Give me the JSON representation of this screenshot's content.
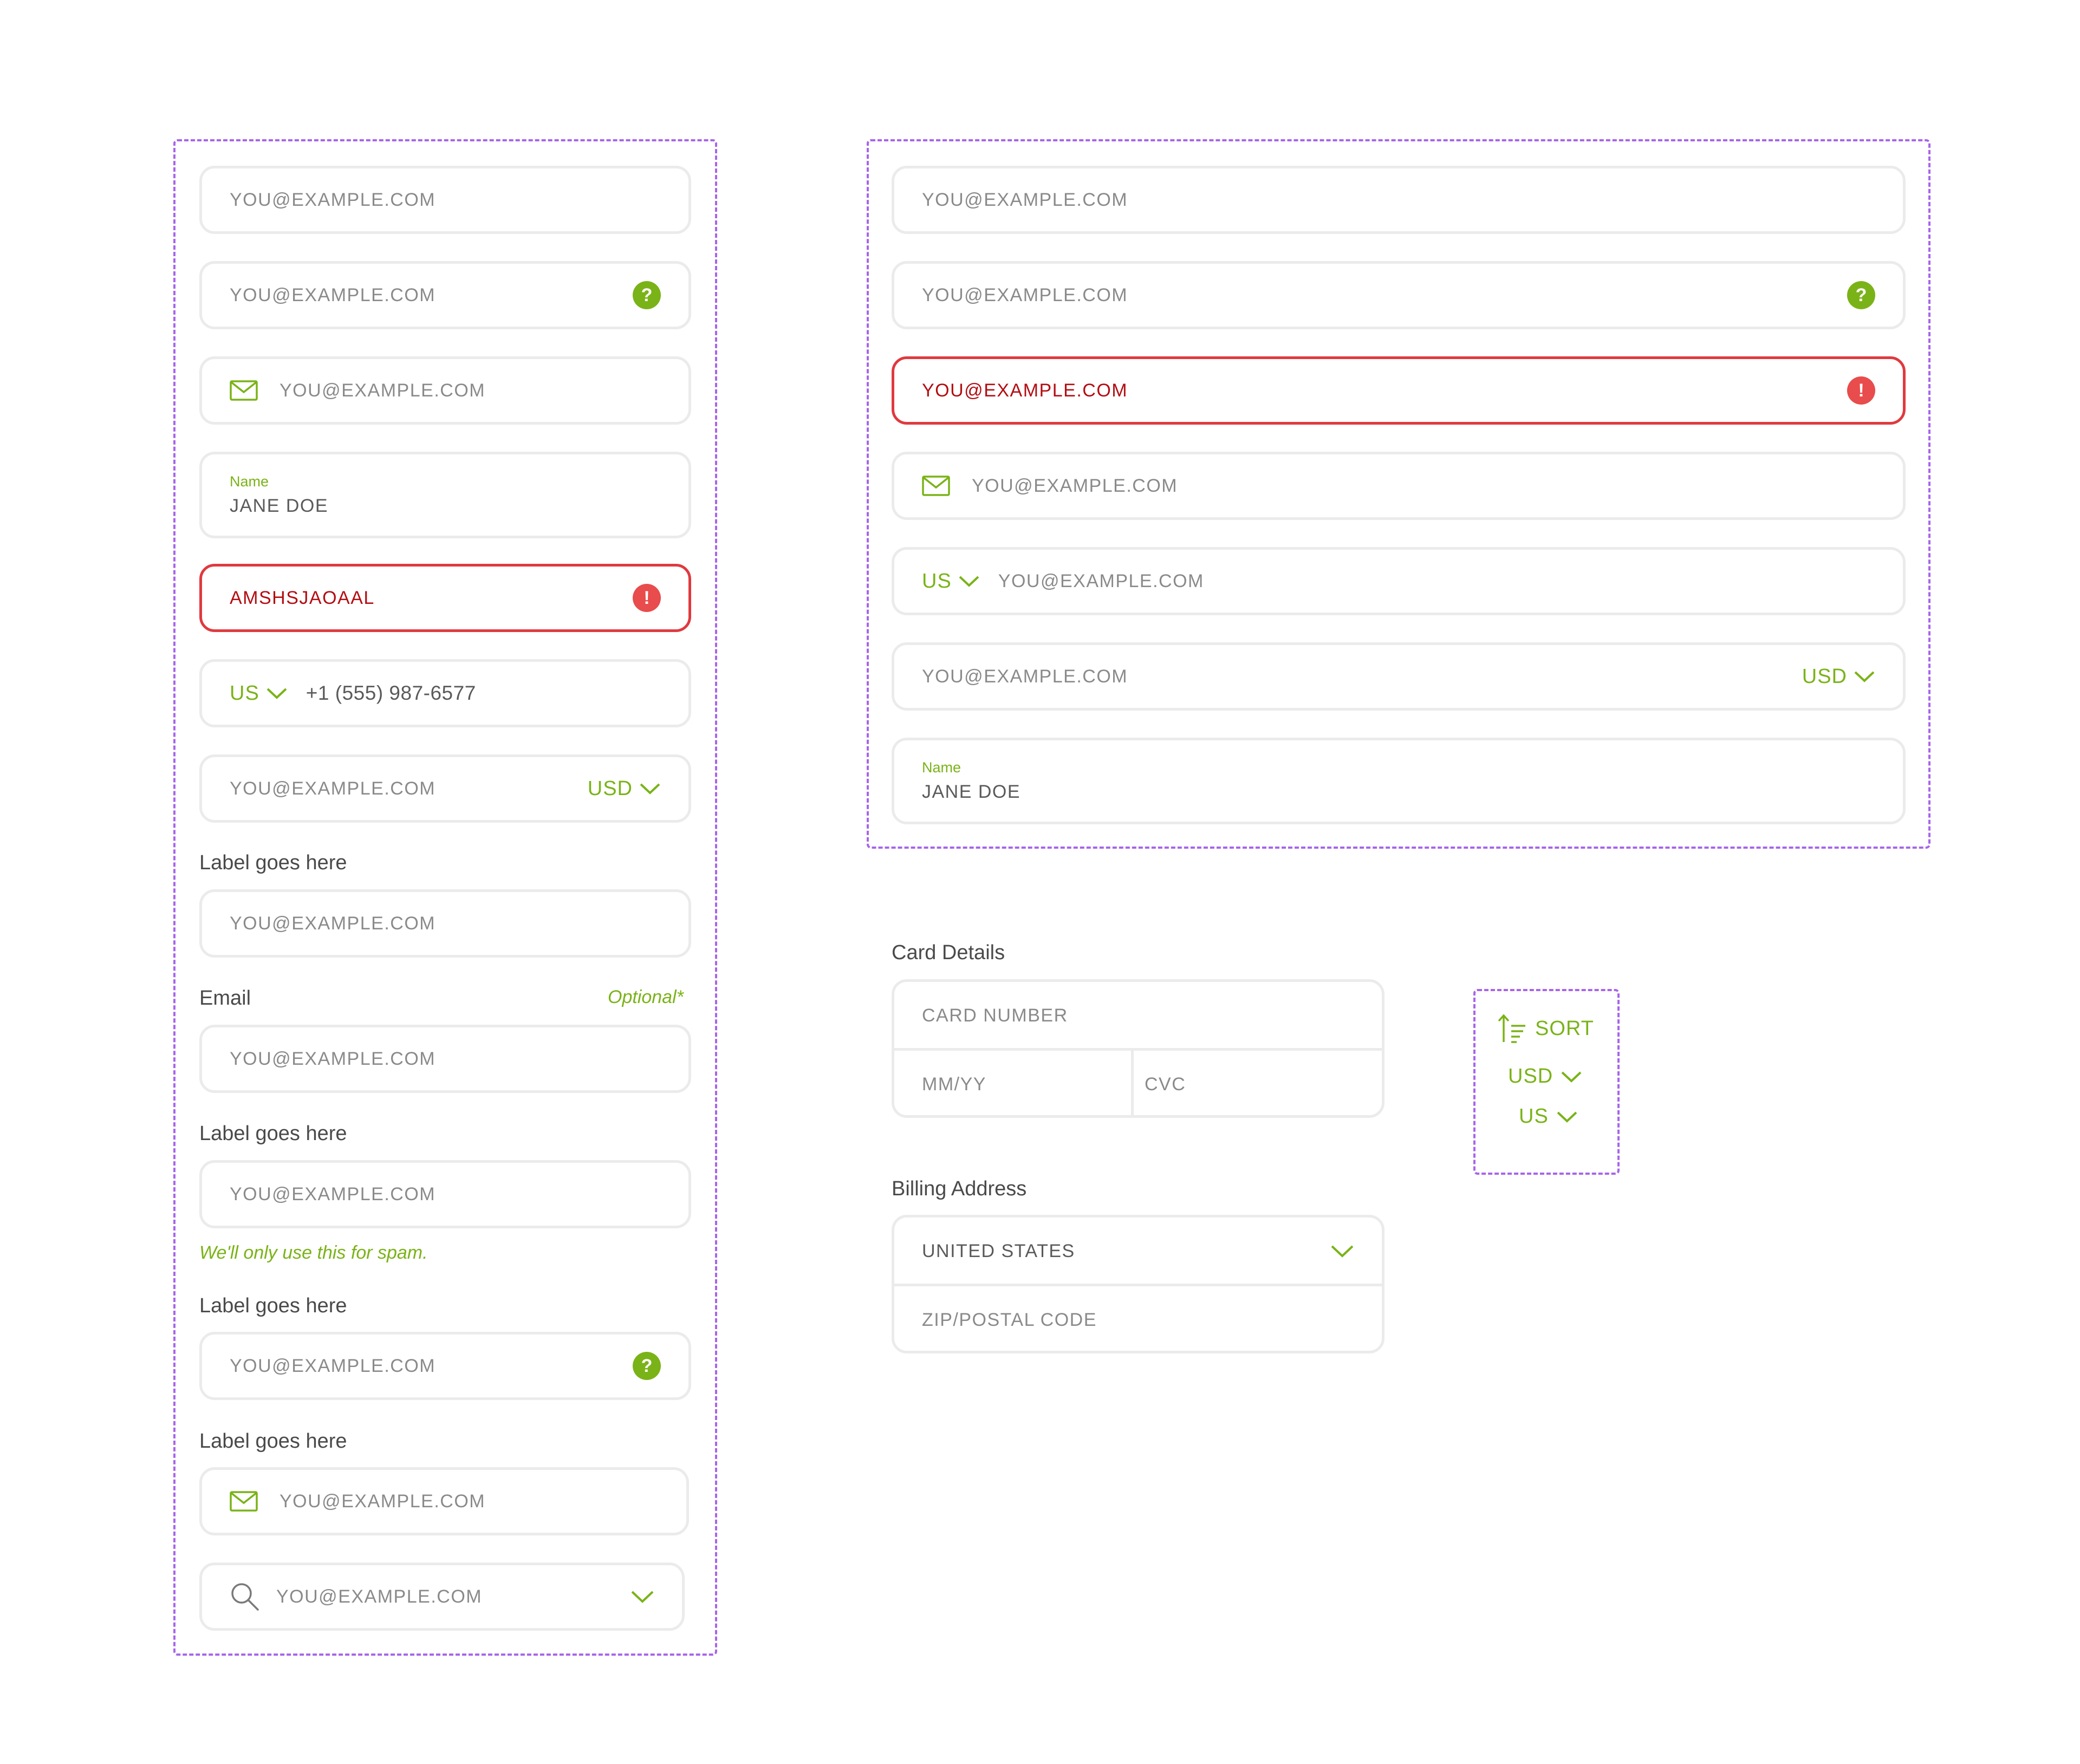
{
  "colors": {
    "accent": "#7ab317",
    "error": "#e0393e",
    "frame": "#a765ea",
    "border": "#ebebeb"
  },
  "left": {
    "f1": {
      "value": "YOU@EXAMPLE.COM"
    },
    "f2": {
      "value": "YOU@EXAMPLE.COM",
      "icon": "help-icon",
      "badge": "?"
    },
    "f3": {
      "value": "YOU@EXAMPLE.COM",
      "icon": "mail-icon"
    },
    "f4": {
      "label": "Name",
      "value": "JANE DOE"
    },
    "f5": {
      "value": "AMSHSJAOAAL",
      "icon": "error-icon",
      "badge": "!"
    },
    "f6": {
      "country": "US",
      "value": "+1 (555) 987-6577"
    },
    "f7": {
      "value": "YOU@EXAMPLE.COM",
      "currency": "USD"
    },
    "f8": {
      "label": "Label goes here",
      "value": "YOU@EXAMPLE.COM"
    },
    "f9": {
      "label": "Email",
      "optional": "Optional*",
      "value": "YOU@EXAMPLE.COM"
    },
    "f10": {
      "label": "Label goes here",
      "value": "YOU@EXAMPLE.COM",
      "hint": "We'll only use this for spam."
    },
    "f11": {
      "label": "Label goes here",
      "value": "YOU@EXAMPLE.COM",
      "badge": "?"
    },
    "f12": {
      "label": "Label goes here",
      "value": "YOU@EXAMPLE.COM"
    },
    "f13": {
      "value": "YOU@EXAMPLE.COM",
      "icon": "search-icon"
    }
  },
  "right": {
    "r1": {
      "value": "YOU@EXAMPLE.COM"
    },
    "r2": {
      "value": "YOU@EXAMPLE.COM",
      "badge": "?"
    },
    "r3": {
      "value": "YOU@EXAMPLE.COM",
      "badge": "!"
    },
    "r4": {
      "value": "YOU@EXAMPLE.COM"
    },
    "r5": {
      "country": "US",
      "value": "YOU@EXAMPLE.COM"
    },
    "r6": {
      "value": "YOU@EXAMPLE.COM",
      "currency": "USD"
    },
    "r7": {
      "label": "Name",
      "value": "JANE DOE"
    }
  },
  "card": {
    "title": "Card Details",
    "number_placeholder": "CARD NUMBER",
    "expiry_placeholder": "MM/YY",
    "cvc_placeholder": "CVC"
  },
  "billing": {
    "title": "Billing Address",
    "country": "UNITED STATES",
    "zip_placeholder": "ZIP/POSTAL CODE"
  },
  "sortbox": {
    "sort": "SORT",
    "currency": "USD",
    "country": "US"
  }
}
